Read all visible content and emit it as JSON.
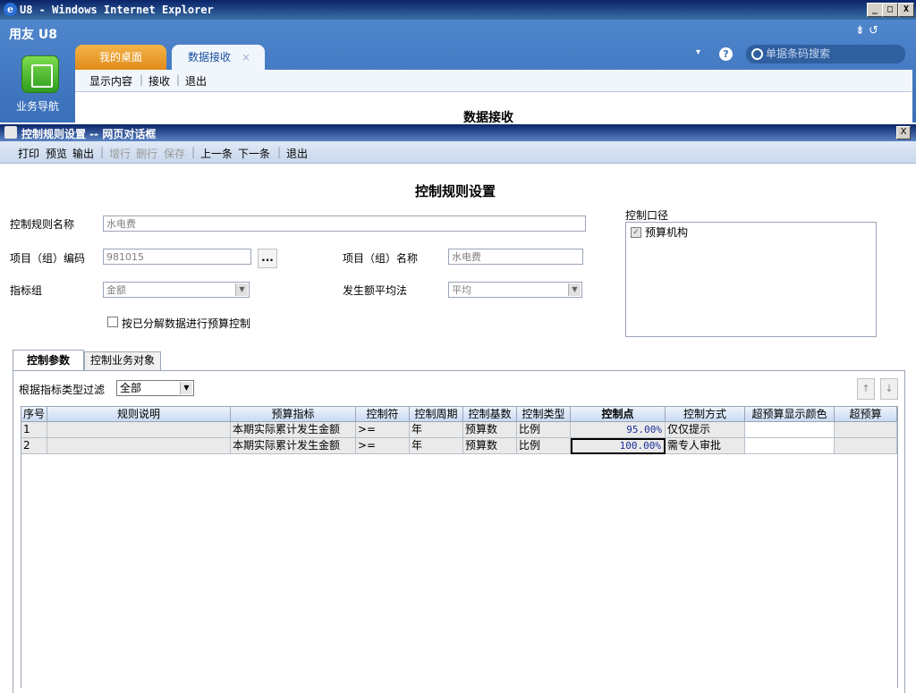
{
  "browser": {
    "title": "U8 - Windows Internet Explorer",
    "min_btn": "_",
    "max_btn": "□",
    "close_btn": "X"
  },
  "app": {
    "brand": "用友 U8",
    "nav_label": "业务导航",
    "tabs": [
      {
        "label": "我的桌面"
      },
      {
        "label": "数据接收",
        "close": "×"
      }
    ],
    "subbar": [
      "显示内容",
      "|",
      "接收",
      "|",
      "退出"
    ],
    "content_title": "数据接收",
    "search_placeholder": "单据条码搜索",
    "help": "?",
    "dropdown": "▾",
    "top_icons": "⇟  ↺"
  },
  "dialog": {
    "title": "控制规则设置 -- 网页对话框",
    "close": "X",
    "toolbar": {
      "print": "打印",
      "preview": "预览",
      "output": "输出",
      "add_row": "增行",
      "del_row": "删行",
      "save": "保存",
      "prev": "上一条",
      "next": "下一条",
      "exit": "退出",
      "sep": "|"
    },
    "form_title": "控制规则设置",
    "fields": {
      "rule_name_label": "控制规则名称",
      "rule_name_value": "水电费",
      "item_code_label": "项目（组）编码",
      "item_code_value": "981015",
      "dots": "...",
      "item_name_label": "项目（组）名称",
      "item_name_value": "水电费",
      "indicator_group_label": "指标组",
      "indicator_group_value": "金额",
      "avg_method_label": "发生额平均法",
      "avg_method_value": "平均",
      "decompose_label": "按已分解数据进行预算控制",
      "combo_arrow": "▼"
    },
    "caliber": {
      "label": "控制口径",
      "items": [
        {
          "label": "预算机构",
          "checked": "✓"
        }
      ]
    },
    "tabs": [
      {
        "label": "控制参数"
      },
      {
        "label": "控制业务对象"
      }
    ],
    "filter": {
      "label": "根据指标类型过滤",
      "value": "全部",
      "up": "↑",
      "down": "↓"
    },
    "grid": {
      "headers": [
        "序号",
        "规则说明",
        "预算指标",
        "控制符",
        "控制周期",
        "控制基数",
        "控制类型",
        "控制点",
        "控制方式",
        "超预算显示颜色",
        "超预算"
      ],
      "rows": [
        [
          "1",
          "",
          "本期实际累计发生金额",
          ">=",
          "年",
          "预算数",
          "比例",
          "95.00%",
          "仅仅提示",
          "",
          ""
        ],
        [
          "2",
          "",
          "本期实际累计发生金额",
          ">=",
          "年",
          "预算数",
          "比例",
          "100.00%",
          "需专人审批",
          "",
          ""
        ]
      ]
    }
  }
}
